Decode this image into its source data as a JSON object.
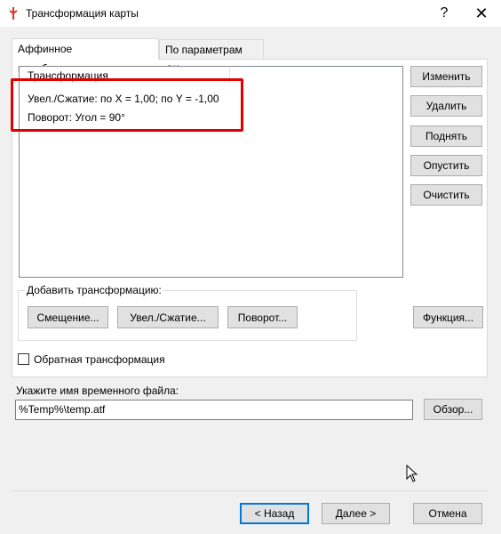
{
  "window": {
    "title": "Трансформация карты",
    "help_glyph": "?",
    "close_glyph": "✕"
  },
  "tabs": [
    {
      "label": "Аффинное преобразование",
      "active": true
    },
    {
      "label": "По параметрам СК",
      "active": false
    }
  ],
  "list": {
    "header": "Трансформация",
    "items": [
      "Увел./Сжатие: по X = 1,00; по Y = -1,00",
      "Поворот: Угол = 90°"
    ]
  },
  "side_buttons": {
    "edit": "Изменить",
    "delete": "Удалить",
    "up": "Поднять",
    "down": "Опустить",
    "clear": "Очистить"
  },
  "add_group": {
    "label": "Добавить трансформацию:",
    "shift": "Смещение...",
    "scale": "Увел./Сжатие...",
    "rotate": "Поворот..."
  },
  "function_button": "Функция...",
  "inverse_checkbox": {
    "label": "Обратная трансформация",
    "checked": false
  },
  "temp_file": {
    "label": "Укажите имя временного файла:",
    "value": "%Temp%\\temp.atf",
    "browse": "Обзор..."
  },
  "footer": {
    "back": "< Назад",
    "next": "Далее >",
    "cancel": "Отмена"
  },
  "colors": {
    "highlight": "#e00000",
    "accent": "#0078d7",
    "app_icon": "#d9342b"
  }
}
